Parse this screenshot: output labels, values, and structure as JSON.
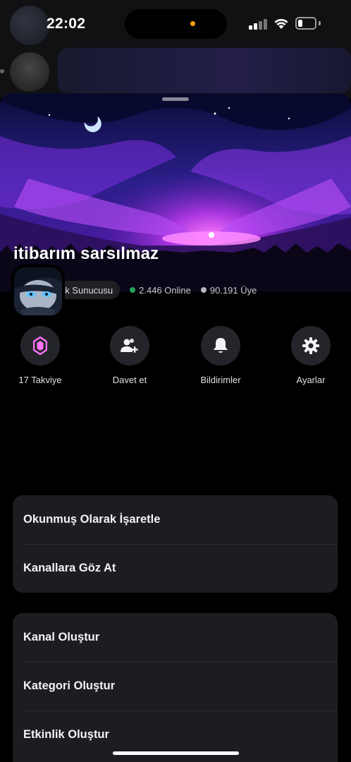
{
  "status_bar": {
    "time": "22:02",
    "battery_level": 0.25
  },
  "server": {
    "name": "itibarım sarsılmaz",
    "community_label": "Topluluk Sunucusu",
    "online_count": "2.446 Online",
    "member_count": "90.191 Üye"
  },
  "actions": [
    {
      "label": "17 Takviye",
      "icon": "boost-gem-icon"
    },
    {
      "label": "Davet et",
      "icon": "add-user-icon"
    },
    {
      "label": "Bildirimler",
      "icon": "bell-icon"
    },
    {
      "label": "Ayarlar",
      "icon": "gear-icon"
    }
  ],
  "menu_group_1": [
    {
      "label": "Okunmuş Olarak İşaretle"
    },
    {
      "label": "Kanallara Göz At"
    }
  ],
  "menu_group_2": [
    {
      "label": "Kanal Oluştur"
    },
    {
      "label": "Kategori Oluştur"
    },
    {
      "label": "Etkinlik Oluştur"
    }
  ],
  "colors": {
    "online": "#23a55a",
    "offline": "#b5bac1",
    "boost": "#ff73fa",
    "surface": "#1c1d21",
    "action_bg": "#24252a"
  }
}
